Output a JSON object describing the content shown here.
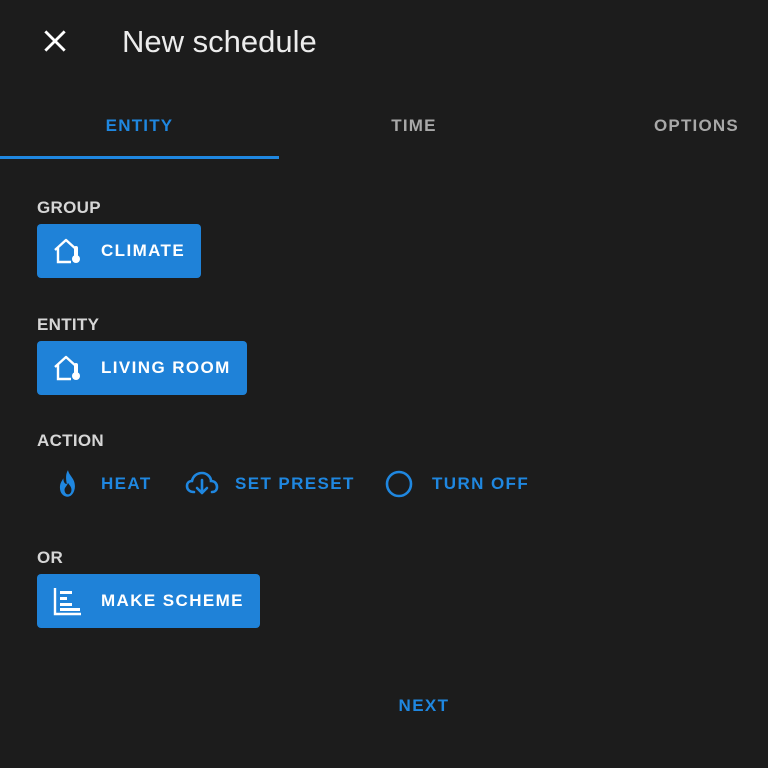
{
  "header": {
    "title": "New schedule",
    "close_icon": "close-icon"
  },
  "tabs": [
    {
      "label": "ENTITY",
      "active": true
    },
    {
      "label": "TIME",
      "active": false
    },
    {
      "label": "OPTIONS",
      "active": false
    }
  ],
  "sections": {
    "group": {
      "label": "GROUP",
      "chip": {
        "label": "CLIMATE",
        "icon": "home-thermometer-icon"
      }
    },
    "entity": {
      "label": "ENTITY",
      "chip": {
        "label": "LIVING ROOM",
        "icon": "home-thermometer-icon"
      }
    },
    "action": {
      "label": "ACTION",
      "items": [
        {
          "label": "HEAT",
          "icon": "fire-icon"
        },
        {
          "label": "SET PRESET",
          "icon": "cloud-download-icon"
        },
        {
          "label": "TURN OFF",
          "icon": "circle-outline-icon"
        }
      ]
    },
    "or": {
      "label": "OR",
      "chip": {
        "label": "MAKE SCHEME",
        "icon": "chart-timeline-icon"
      }
    }
  },
  "footer": {
    "next_label": "NEXT"
  },
  "colors": {
    "background": "#1c1c1c",
    "accent": "#1f87e0",
    "chip": "#1f82d8",
    "text": "#e1e1e1"
  }
}
